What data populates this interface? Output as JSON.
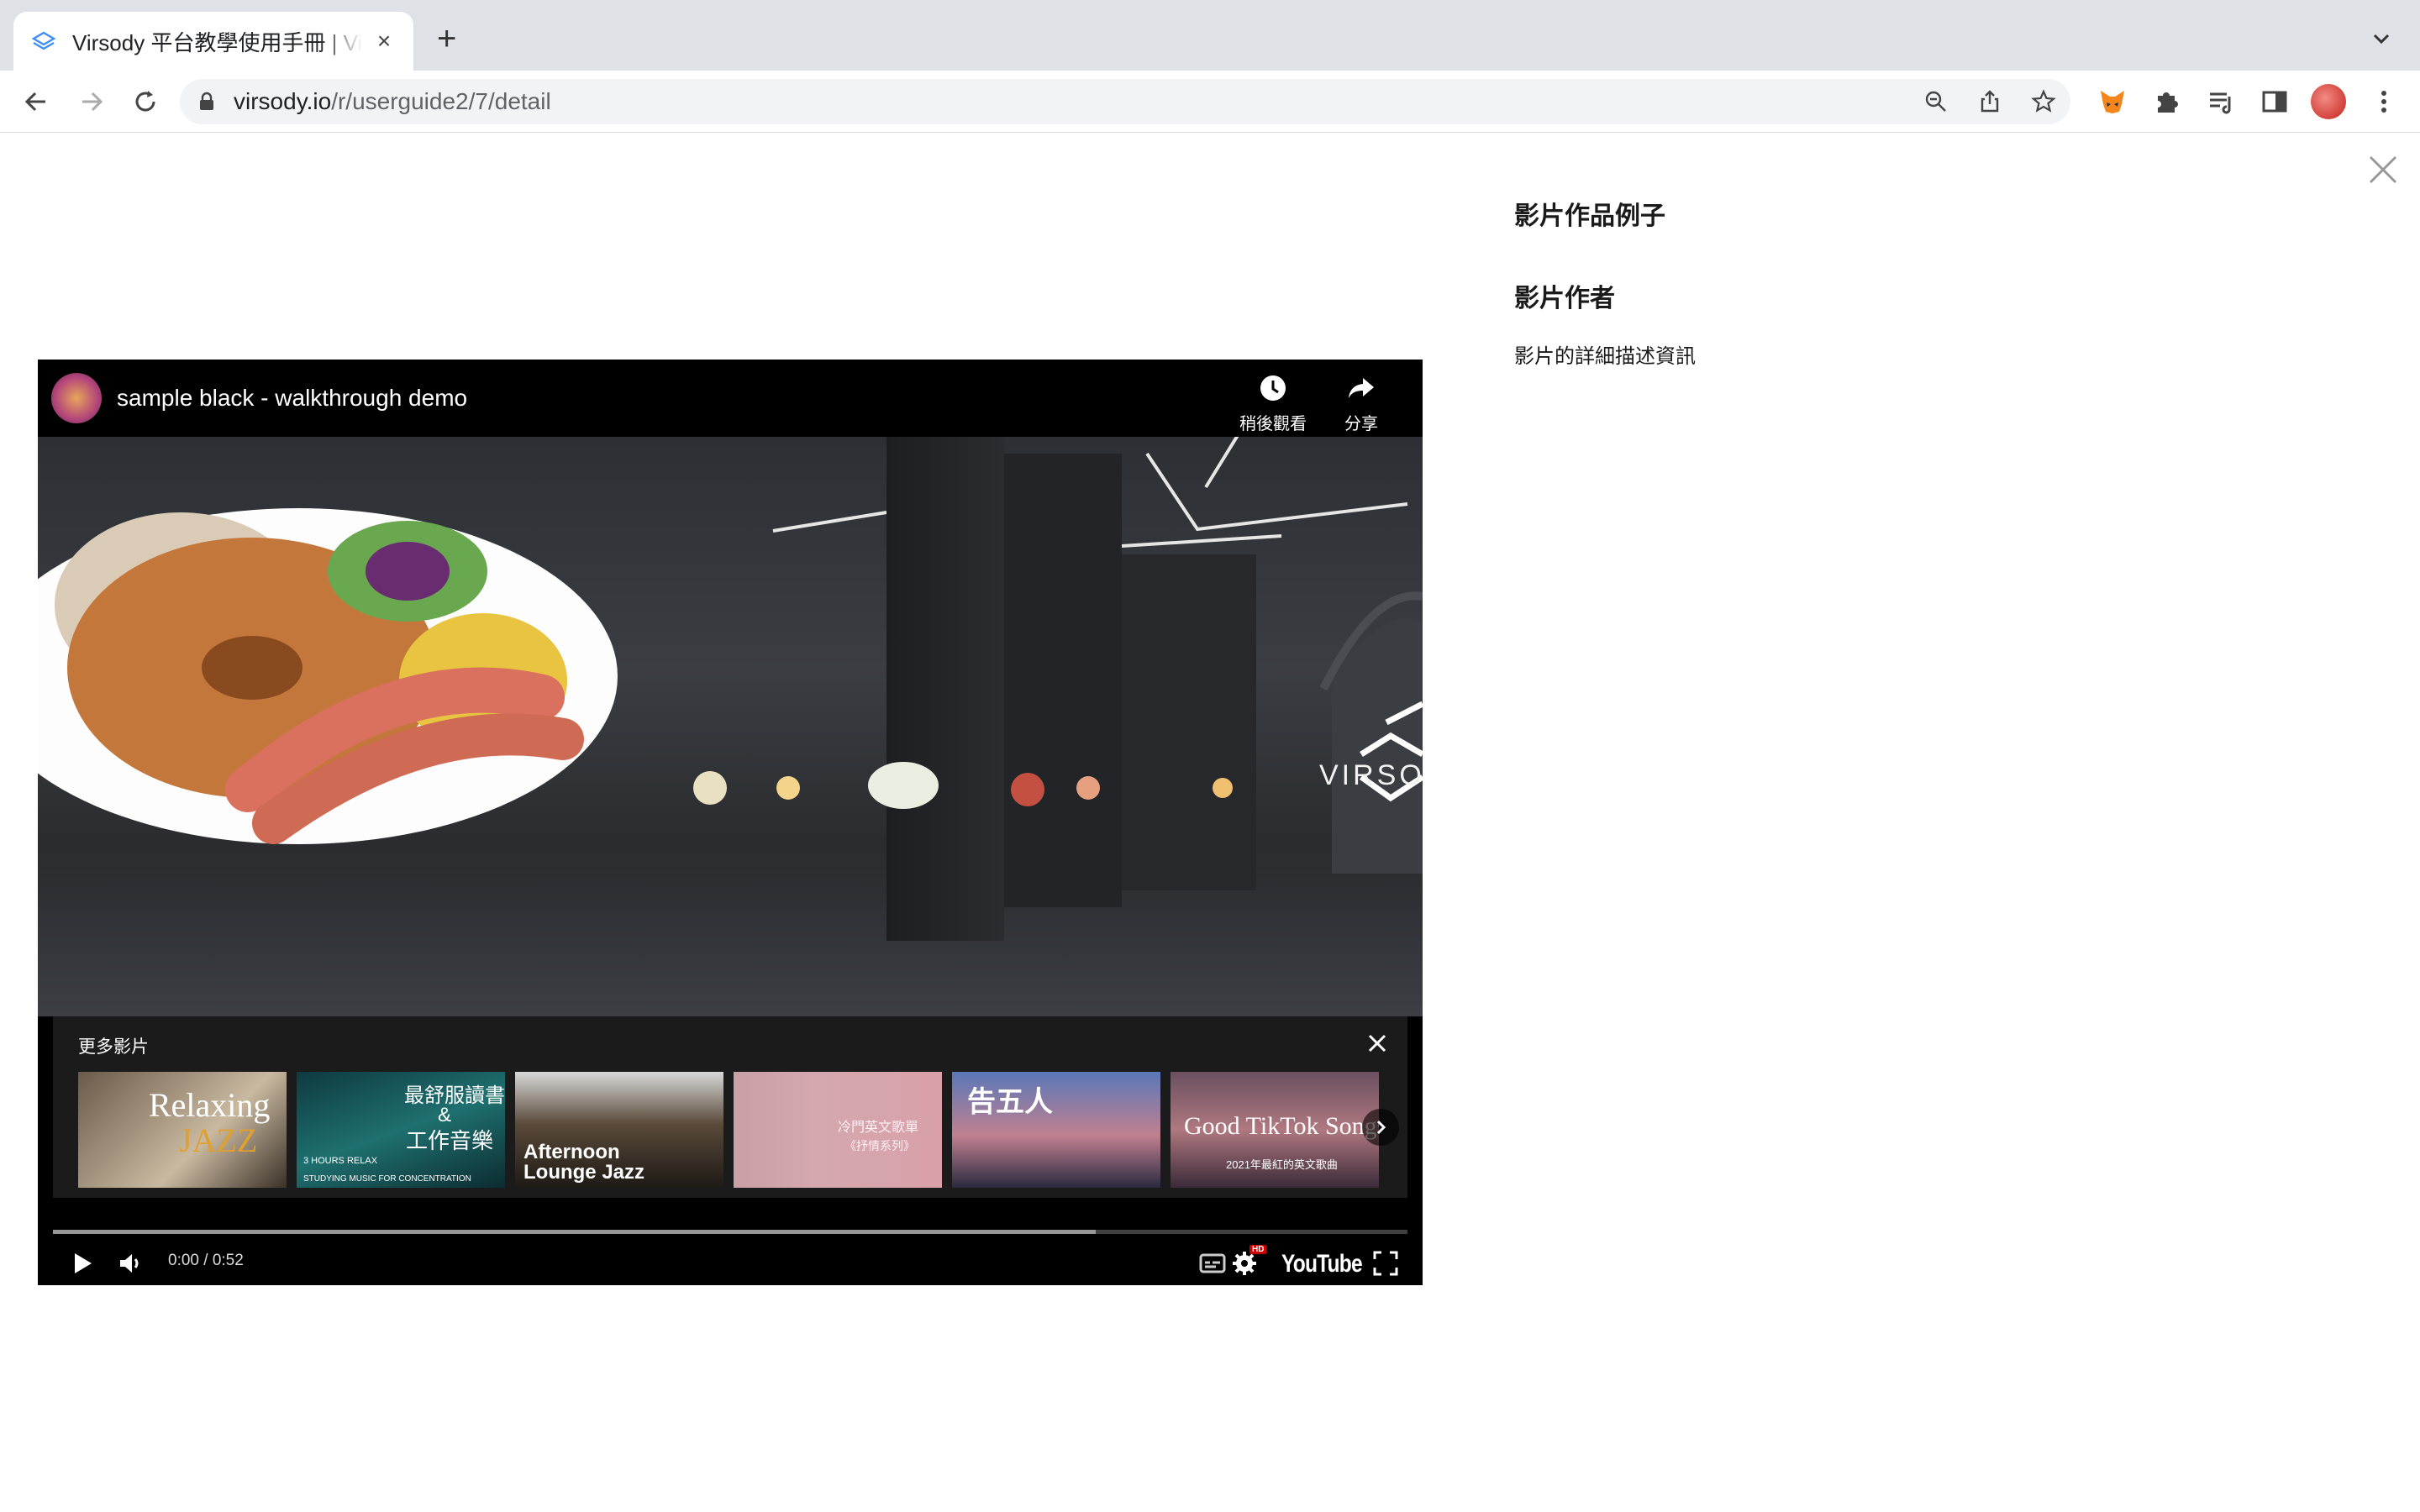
{
  "browser": {
    "tab_title": "Virsody 平台教學使用手冊 | Virsody",
    "tab_close": "×",
    "new_tab": "+",
    "url_host": "virsody.io",
    "url_path": "/r/userguide2/7/detail"
  },
  "detail": {
    "title": "影片作品例子",
    "author": "影片作者",
    "description": "影片的詳細描述資訊"
  },
  "player": {
    "video_title": "sample black - walkthrough demo",
    "watch_later_label": "稍後觀看",
    "share_label": "分享",
    "more_videos_label": "更多影片",
    "time": "0:00 / 0:52",
    "youtube_label": "YouTube",
    "hd_label": "HD",
    "buffered_fraction": 0.77,
    "scene_logo_text": "VIRSO",
    "thumbnails": [
      {
        "line1": "Relaxing",
        "line2": "JAZZ"
      },
      {
        "line1": "最舒服讀書",
        "line2": "&",
        "line3": "工作音樂",
        "line4": "3 HOURS RELAX",
        "line5": "STUDYING MUSIC FOR CONCENTRATION"
      },
      {
        "line1": "Afternoon",
        "line2": "Lounge Jazz"
      },
      {
        "line1": "冷門英文歌單",
        "line2": "《抒情系列》"
      },
      {
        "line1": "告五人"
      },
      {
        "line1": "Good TikTok Songs",
        "line2": "2021年最紅的英文歌曲"
      }
    ]
  },
  "colors": {
    "accent": "#3e8ef7",
    "player_bg": "#000000",
    "panel_bg": "#1c1c1c"
  }
}
